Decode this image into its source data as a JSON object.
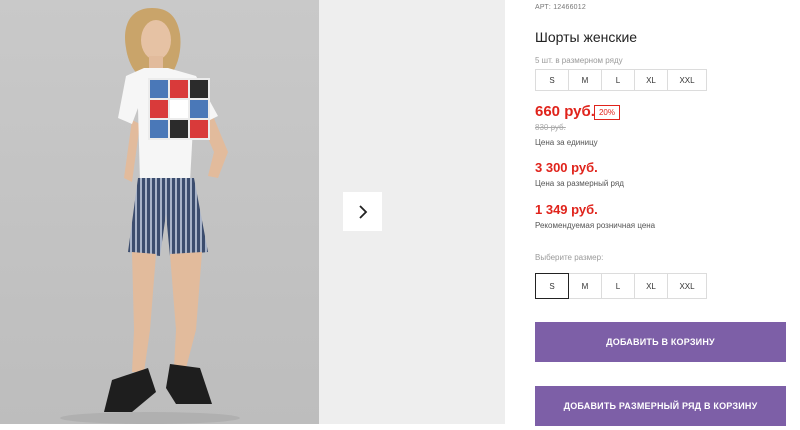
{
  "product": {
    "sku_label": "АРТ:",
    "sku_value": "12466012",
    "title": "Шорты женские",
    "pack_note": "5 шт. в размерном ряду"
  },
  "size_row_reference": [
    "S",
    "M",
    "L",
    "XL",
    "XXL"
  ],
  "pricing": {
    "price": "660 руб.",
    "discount": "20%",
    "old_price": "830 руб.",
    "unit_label": "Цена за единицу",
    "row_price": "3 300 руб.",
    "row_label": "Цена за размерный ряд",
    "rrp": "1 349 руб.",
    "rrp_label": "Рекомендуемая розничная цена"
  },
  "size_picker": {
    "label": "Выберите размер:",
    "options": [
      "S",
      "M",
      "L",
      "XL",
      "XXL"
    ],
    "selected": "S"
  },
  "buttons": {
    "add_to_cart": "ДОБАВИТЬ В КОРЗИНУ",
    "add_row_to_cart": "ДОБАВИТЬ РАЗМЕРНЫЙ РЯД В КОРЗИНУ"
  },
  "colors": {
    "accent": "#7d5fa7",
    "price_red": "#e0231b"
  },
  "icons": {
    "next": "chevron-right-icon"
  }
}
